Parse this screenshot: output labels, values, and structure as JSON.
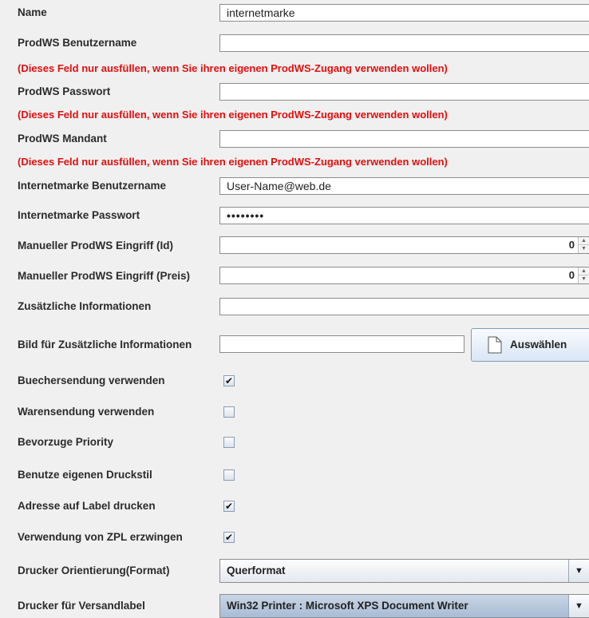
{
  "fields": {
    "name": {
      "label": "Name",
      "value": "internetmarke"
    },
    "prodws_user": {
      "label": "ProdWS Benutzername",
      "value": ""
    },
    "prodws_user_hint": "(Dieses Feld nur ausfüllen, wenn Sie ihren eigenen ProdWS-Zugang verwenden wollen)",
    "prodws_pass": {
      "label": "ProdWS Passwort",
      "value": ""
    },
    "prodws_pass_hint": "(Dieses Feld nur ausfüllen, wenn Sie ihren eigenen ProdWS-Zugang verwenden wollen)",
    "prodws_mandant": {
      "label": "ProdWS Mandant",
      "value": ""
    },
    "prodws_mandant_hint": "(Dieses Feld nur ausfüllen, wenn Sie ihren eigenen ProdWS-Zugang verwenden wollen)",
    "im_user": {
      "label": "Internetmarke Benutzername",
      "value": "User-Name@web.de"
    },
    "im_pass": {
      "label": "Internetmarke Passwort",
      "value": "••••••••"
    },
    "manual_id": {
      "label": "Manueller ProdWS Eingriff (Id)",
      "value": "0"
    },
    "manual_price": {
      "label": "Manueller ProdWS Eingriff (Preis)",
      "value": "0"
    },
    "extra_info": {
      "label": "Zusätzliche Informationen",
      "value": ""
    },
    "extra_image": {
      "label": "Bild für Zusätzliche Informationen",
      "value": "",
      "button_label": "Auswählen"
    }
  },
  "checkboxes": [
    {
      "label": "Buechersendung verwenden",
      "checked": true
    },
    {
      "label": "Warensendung verwenden",
      "checked": false
    },
    {
      "label": "Bevorzuge Priority",
      "checked": false
    },
    {
      "label": "Benutze eigenen Druckstil",
      "checked": false
    },
    {
      "label": "Adresse auf Label drucken",
      "checked": true
    },
    {
      "label": "Verwendung von ZPL erzwingen",
      "checked": true
    }
  ],
  "combos": {
    "orientation": {
      "label": "Drucker Orientierung(Format)",
      "value": "Querformat"
    },
    "printer": {
      "label": "Drucker für Versandlabel",
      "value": "Win32 Printer : Microsoft XPS Document Writer"
    }
  },
  "icons": {
    "check": "✔",
    "dropdown": "▼",
    "spin_up": "▲",
    "spin_down": "▼"
  }
}
